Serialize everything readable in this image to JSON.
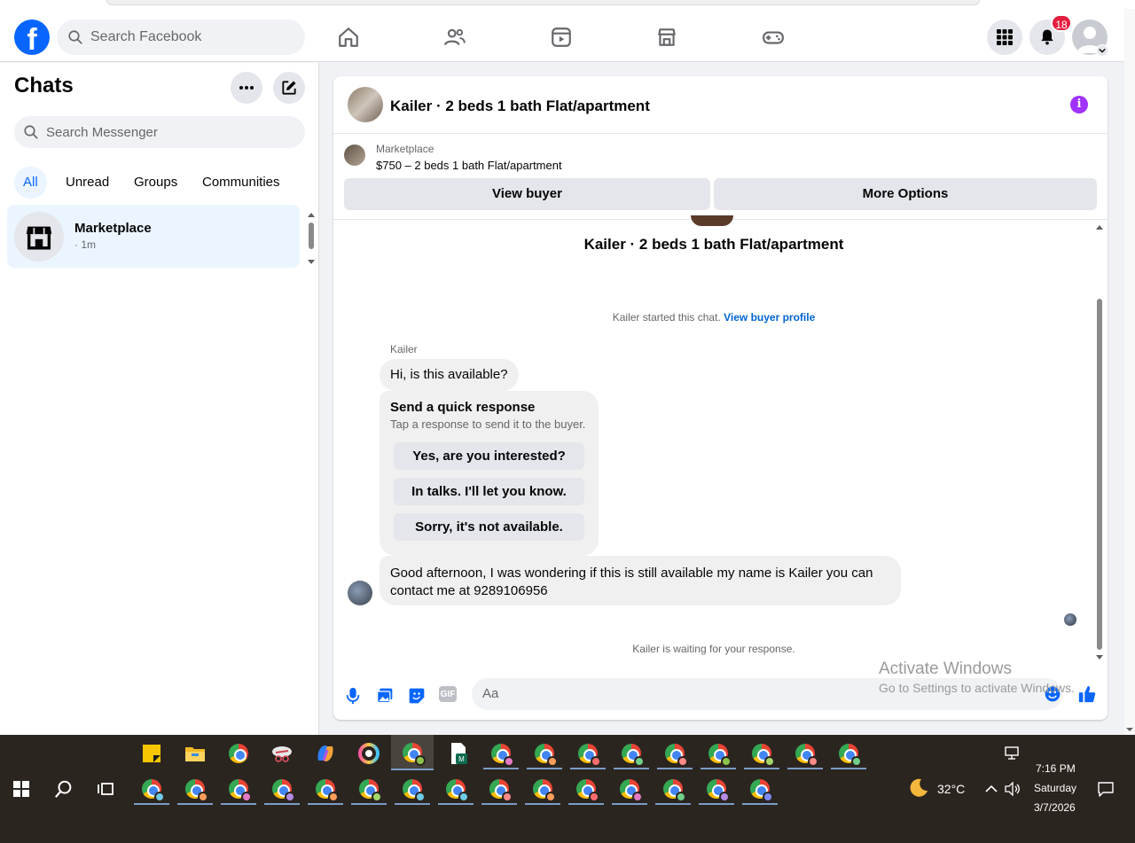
{
  "topnav": {
    "logo": "f",
    "search_placeholder": "Search Facebook",
    "notification_count": "18"
  },
  "left": {
    "title": "Chats",
    "search_placeholder": "Search Messenger",
    "filters": [
      "All",
      "Unread",
      "Groups",
      "Communities"
    ],
    "chat": {
      "name": "Marketplace",
      "time": "· 1m"
    }
  },
  "convo": {
    "title": "Kailer · 2 beds 1 bath Flat/apartment",
    "marketplace_label": "Marketplace",
    "listing": "$750 – 2 beds 1 bath Flat/apartment",
    "view_buyer": "View buyer",
    "more_options": "More Options",
    "center_title": "Kailer · 2 beds 1 bath Flat/apartment",
    "started_text": "Kailer started this chat.",
    "started_link": "View buyer profile",
    "sender": "Kailer",
    "msg1": "Hi, is this available?",
    "quick_title": "Send a quick response",
    "quick_sub": "Tap a response to send it to the buyer.",
    "quick_options": [
      "Yes, are you interested?",
      "In talks. I'll let you know.",
      "Sorry, it's not available."
    ],
    "msg2": "Good afternoon, I was wondering if this is still available my name is Kailer you can contact me at 9289106956",
    "waiting": "Kailer is waiting for your response.",
    "composer_placeholder": "Aa",
    "gif_label": "GIF"
  },
  "watermark": {
    "line1": "Activate Windows",
    "line2": "Go to Settings to activate Windows."
  },
  "taskbar": {
    "temperature": "32°C",
    "time": "7:16 PM",
    "day": "Saturday",
    "date": "3/7/2026"
  },
  "colors": {
    "brand": "#0866ff",
    "info": "#a033ff",
    "badge": "#e41e3f",
    "active_filter_bg": "#ebf5ff"
  }
}
